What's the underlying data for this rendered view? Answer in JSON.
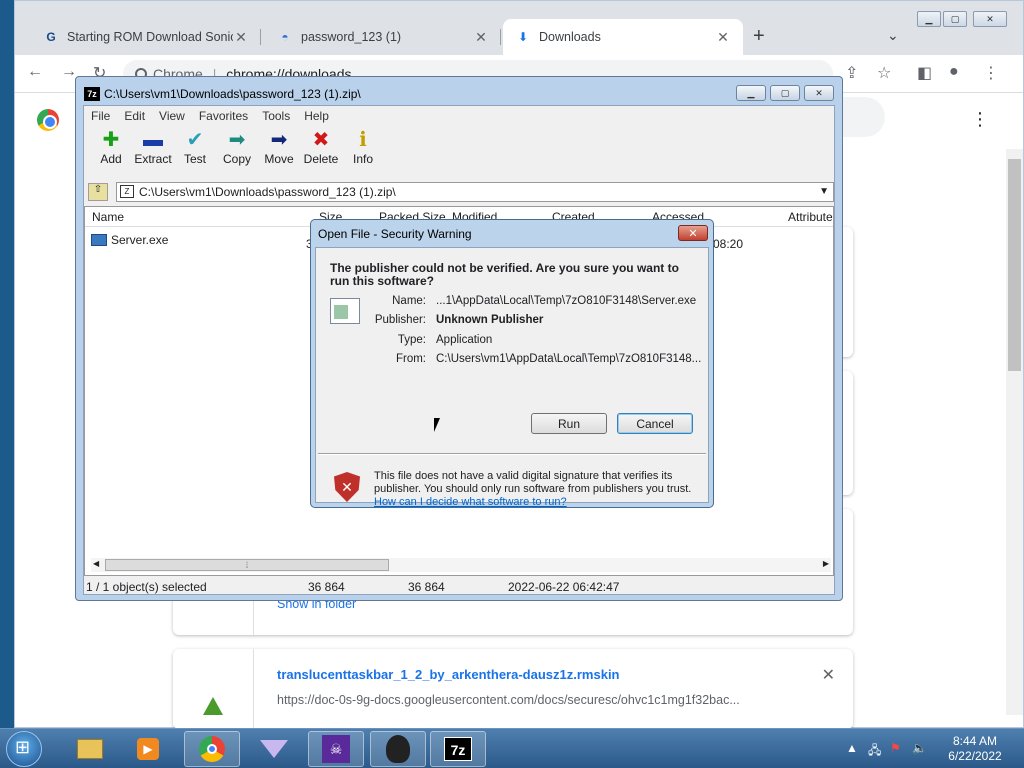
{
  "browser": {
    "tabs": [
      {
        "title": "Starting ROM Download Sonic Th",
        "icon": "tab-site-icon"
      },
      {
        "title": "password_123 (1)",
        "icon": "tab-cloud-icon"
      },
      {
        "title": "Downloads",
        "icon": "download-icon"
      }
    ],
    "omnibox": {
      "chip": "Chrome",
      "url": "chrome://downloads"
    },
    "downloads": {
      "show_in_folder": "Show in folder",
      "item2": {
        "name": "translucenttaskbar_1_2_by_arkenthera-dausz1z.rmskin",
        "url": "https://doc-0s-9g-docs.googleusercontent.com/docs/securesc/ohvc1c1mg1f32bac..."
      }
    }
  },
  "sevenzip": {
    "title": "C:\\Users\\vm1\\Downloads\\password_123 (1).zip\\",
    "menu": [
      "File",
      "Edit",
      "View",
      "Favorites",
      "Tools",
      "Help"
    ],
    "tools": [
      {
        "label": "Add",
        "icon": "plus-icon",
        "glyph": "✚",
        "color": "#18a018"
      },
      {
        "label": "Extract",
        "icon": "minus-icon",
        "glyph": "▬",
        "color": "#1a3ca8"
      },
      {
        "label": "Test",
        "icon": "check-icon",
        "glyph": "✔",
        "color": "#2aa0b8"
      },
      {
        "label": "Copy",
        "icon": "copy-arrow-icon",
        "glyph": "➡",
        "color": "#1e8a80"
      },
      {
        "label": "Move",
        "icon": "move-arrow-icon",
        "glyph": "➡",
        "color": "#14287a"
      },
      {
        "label": "Delete",
        "icon": "delete-x-icon",
        "glyph": "✖",
        "color": "#d01818"
      },
      {
        "label": "Info",
        "icon": "info-icon",
        "glyph": "ℹ",
        "color": "#c0a000"
      }
    ],
    "path": "C:\\Users\\vm1\\Downloads\\password_123 (1).zip\\",
    "columns": {
      "name": "Name",
      "size": "Size",
      "packed": "Packed Size",
      "modified": "Modified",
      "created": "Created",
      "accessed": "Accessed",
      "attributes": "Attribute"
    },
    "row": {
      "name": "Server.exe",
      "size_partial": "3",
      "accessed_partial": "08:20"
    },
    "status": {
      "selected": "1 / 1 object(s) selected",
      "size": "36 864",
      "packed": "36 864",
      "modified": "2022-06-22 06:42:47"
    }
  },
  "dialog": {
    "title": "Open File - Security Warning",
    "question": "The publisher could not be verified.  Are you sure you want to run this software?",
    "fields": [
      {
        "label": "Name:",
        "value": "...1\\AppData\\Local\\Temp\\7zO810F3148\\Server.exe",
        "bold": false
      },
      {
        "label": "Publisher:",
        "value": "Unknown Publisher",
        "bold": true
      },
      {
        "label": "Type:",
        "value": "Application",
        "bold": false
      },
      {
        "label": "From:",
        "value": "C:\\Users\\vm1\\AppData\\Local\\Temp\\7zO810F3148...",
        "bold": false
      }
    ],
    "run_label": "Run",
    "cancel_label": "Cancel",
    "warning": "This file does not have a valid digital signature that verifies its publisher.  You should only run software from publishers you trust.",
    "link": "How can I decide what software to run?"
  },
  "taskbar": {
    "apps": [
      "explorer-icon",
      "media-player-icon",
      "chrome-icon",
      "rainmeter-icon",
      "game-icon",
      "tor-icon",
      "7zip-icon"
    ],
    "time": "8:44 AM",
    "date": "6/22/2022"
  }
}
